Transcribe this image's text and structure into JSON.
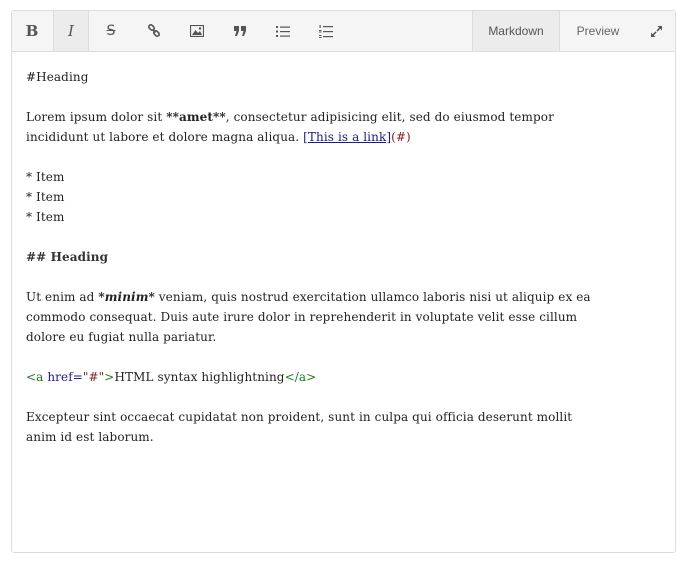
{
  "toolbar": {
    "bold_label": "B",
    "italic_label": "I",
    "strike_label": "S",
    "tabs": [
      {
        "label": "Markdown"
      },
      {
        "label": "Preview"
      }
    ]
  },
  "content": {
    "heading1": "#Heading",
    "para1_a": "Lorem ipsum dolor sit ",
    "para1_bold": "**amet**",
    "para1_b": ", consectetur adipisicing elit, sed do eiusmod tempor",
    "para1_c": "incididunt ut labore et dolore magna aliqua. ",
    "para1_link": "[This is a link]",
    "para1_url": "(#)",
    "list_items": [
      "* Item",
      "* Item",
      "* Item"
    ],
    "heading2": "## Heading",
    "para2_a": "Ut enim ad ",
    "para2_em": "*minim*",
    "para2_b": " veniam, quis nostrud exercitation ullamco laboris nisi ut aliquip ex ea",
    "para2_c": "commodo consequat. Duis aute irure dolor in reprehenderit in voluptate velit esse cillum",
    "para2_d": "dolore eu fugiat nulla pariatur.",
    "html_open": "<a ",
    "html_attr": "href=",
    "html_val": "\"#\"",
    "html_close_open": ">",
    "html_text": "HTML syntax highlightning",
    "html_close": "</a>",
    "para3_a": "Excepteur sint occaecat cupidatat non proident, sunt in culpa qui officia deserunt mollit",
    "para3_b": "anim id est laborum."
  }
}
